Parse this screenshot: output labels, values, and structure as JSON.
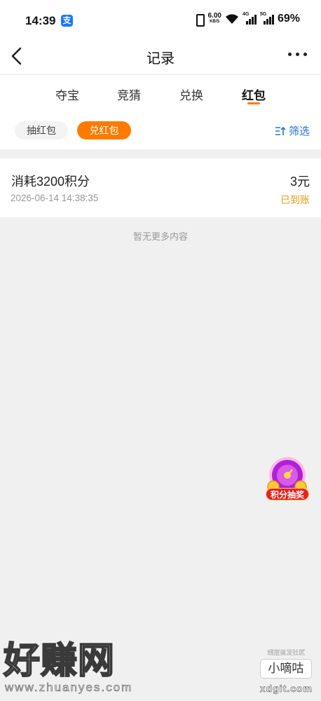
{
  "status_bar": {
    "time": "14:39",
    "alipay_glyph": "支",
    "net_speed": "6.00",
    "net_speed_unit": "KB/S",
    "sim1_label": "4G",
    "sim2_label": "5G",
    "battery": "69%"
  },
  "nav": {
    "title": "记录"
  },
  "tabs": [
    {
      "label": "夺宝",
      "active": false
    },
    {
      "label": "竞猜",
      "active": false
    },
    {
      "label": "兑换",
      "active": false
    },
    {
      "label": "红包",
      "active": true
    }
  ],
  "filters": {
    "chip_grab": "抽红包",
    "chip_redeem": "兑红包",
    "filter_label": "筛选"
  },
  "records": [
    {
      "title": "消耗3200积分",
      "time": "2026-06-14 14:38:35",
      "amount": "3元",
      "status": "已到账"
    }
  ],
  "no_more_text": "暂无更多内容",
  "float": {
    "lottery_label": "积分抽奖"
  },
  "watermark": {
    "left_big": "好赚网",
    "left_url": "www.zhuanyes.com",
    "right_small": "线报首发社区",
    "right_box": "小嘀咕",
    "right_domain": "xdgit.com"
  },
  "colors": {
    "accent": "#ff7a00",
    "link": "#2a73c9",
    "status_done": "#e39b19",
    "background": "#f0f0f0"
  }
}
